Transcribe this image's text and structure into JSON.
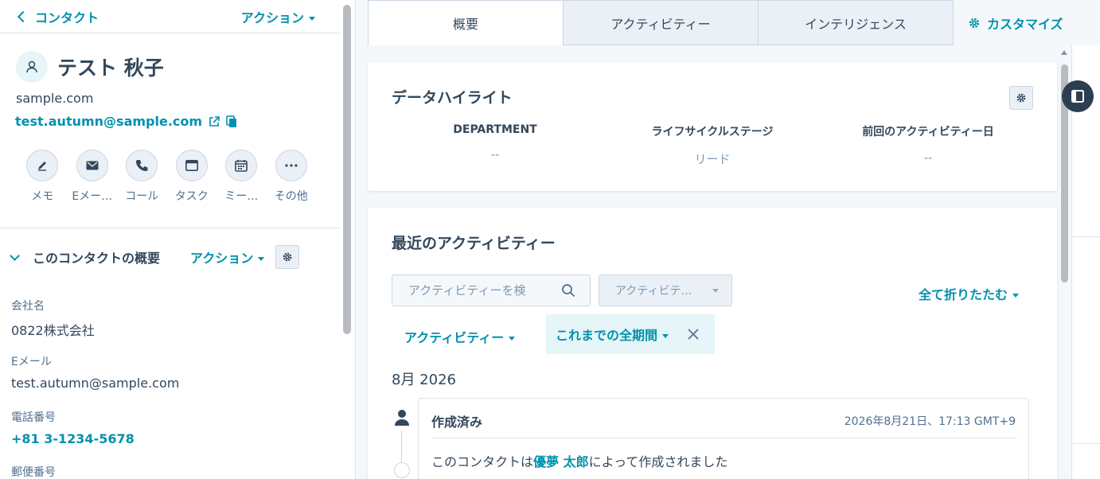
{
  "header": {
    "back_label": "コンタクト",
    "action_label": "アクション"
  },
  "contact": {
    "name": "テスト 秋子",
    "domain": "sample.com",
    "email": "test.autumn@sample.com"
  },
  "quick_actions": [
    {
      "label": "メモ",
      "icon": "edit-icon"
    },
    {
      "label": "Eメー…",
      "icon": "mail-icon"
    },
    {
      "label": "コール",
      "icon": "phone-icon"
    },
    {
      "label": "タスク",
      "icon": "task-icon"
    },
    {
      "label": "ミー…",
      "icon": "calendar-icon"
    },
    {
      "label": "その他",
      "icon": "more-icon"
    }
  ],
  "summary": {
    "title": "このコンタクトの概要",
    "action_label": "アクション",
    "fields": [
      {
        "label": "会社名",
        "value": "0822株式会社"
      },
      {
        "label": "Eメール",
        "value": "test.autumn@sample.com"
      },
      {
        "label": "電話番号",
        "value": "+81 3-1234-5678"
      },
      {
        "label": "郵便番号",
        "value": ""
      }
    ]
  },
  "tabs": [
    {
      "label": "概要",
      "active": true
    },
    {
      "label": "アクティビティー",
      "active": false
    },
    {
      "label": "インテリジェンス",
      "active": false
    }
  ],
  "customize_label": "カスタマイズ",
  "highlights": {
    "title": "データハイライト",
    "items": [
      {
        "label": "DEPARTMENT",
        "value": "--"
      },
      {
        "label": "ライフサイクルステージ",
        "value": "リード"
      },
      {
        "label": "前回のアクティビティー日",
        "value": "--"
      }
    ]
  },
  "activity": {
    "title": "最近のアクティビティー",
    "search_placeholder": "アクティビティーを検",
    "type_dropdown": "アクティビテ…",
    "collapse_all": "全て折りたたむ",
    "filter_activity": "アクティビティー",
    "filter_period": "これまでの全期間",
    "month": "8月 2026",
    "event": {
      "title": "作成済み",
      "time": "2026年8月21日、17:13 GMT+9",
      "body_prefix": "このコンタクトは",
      "body_user": "優夢 太郎",
      "body_suffix": "によって作成されました"
    }
  },
  "colors": {
    "accent": "#0091ae",
    "text": "#33475b",
    "muted": "#516f90",
    "bg": "#f5f8fa",
    "dark": "#2d3e50"
  }
}
